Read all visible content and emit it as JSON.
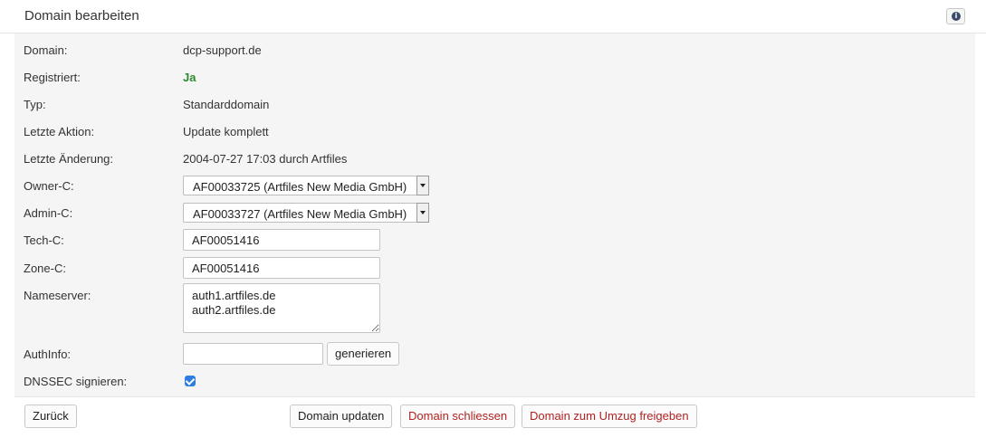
{
  "header": {
    "title": "Domain bearbeiten",
    "info_icon": "info-icon"
  },
  "fields": {
    "domain": {
      "label": "Domain:",
      "value": "dcp-support.de"
    },
    "registered": {
      "label": "Registriert:",
      "value": "Ja",
      "color": "#2d8a2d"
    },
    "type": {
      "label": "Typ:",
      "value": "Standarddomain"
    },
    "last_action": {
      "label": "Letzte Aktion:",
      "value": "Update komplett"
    },
    "last_change": {
      "label": "Letzte Änderung:",
      "value": "2004-07-27 17:03 durch Artfiles"
    },
    "owner_c": {
      "label": "Owner-C:",
      "selected": "AF00033725 (Artfiles New Media GmbH)"
    },
    "admin_c": {
      "label": "Admin-C:",
      "selected": "AF00033727 (Artfiles New Media GmbH)"
    },
    "tech_c": {
      "label": "Tech-C:",
      "value": "AF00051416"
    },
    "zone_c": {
      "label": "Zone-C:",
      "value": "AF00051416"
    },
    "nameserver": {
      "label": "Nameserver:",
      "value": "auth1.artfiles.de\nauth2.artfiles.de"
    },
    "authinfo": {
      "label": "AuthInfo:",
      "value": "",
      "generate_label": "generieren"
    },
    "dnssec": {
      "label": "DNSSEC signieren:",
      "checked": true
    }
  },
  "actions": {
    "back": "Zurück",
    "update": "Domain updaten",
    "close": "Domain schliessen",
    "release": "Domain zum Umzug freigeben"
  },
  "colors": {
    "danger": "#b22222",
    "checkbox": "#2f7de1"
  }
}
